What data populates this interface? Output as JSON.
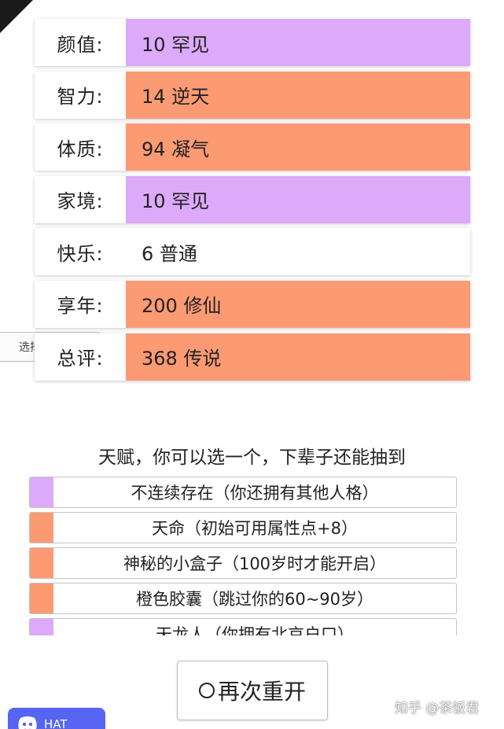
{
  "colors": {
    "purple": "#dcaaf8",
    "orange": "#fc9a74",
    "white": "#ffffff"
  },
  "stats": [
    {
      "label": "颜值:",
      "value": "10 罕见",
      "color": "#dcaaf8"
    },
    {
      "label": "智力:",
      "value": "14 逆天",
      "color": "#fc9a74"
    },
    {
      "label": "体质:",
      "value": "94 凝气",
      "color": "#fc9a74"
    },
    {
      "label": "家境:",
      "value": "10 罕见",
      "color": "#dcaaf8"
    },
    {
      "label": "快乐:",
      "value": "6 普通",
      "color": "#ffffff"
    },
    {
      "label": "享年:",
      "value": "200 修仙",
      "color": "#fc9a74"
    },
    {
      "label": "总评:",
      "value": "368 传说",
      "color": "#fc9a74"
    }
  ],
  "select_stub": {
    "label": "选择"
  },
  "talents": {
    "title": "天赋，你可以选一个，下辈子还能抽到",
    "items": [
      {
        "text": "不连续存在（你还拥有其他人格）",
        "color": "#dcaaf8"
      },
      {
        "text": "天命（初始可用属性点+8）",
        "color": "#fc9a74"
      },
      {
        "text": "神秘的小盒子（100岁时才能开启）",
        "color": "#fc9a74"
      },
      {
        "text": "橙色胶囊（跳过你的60~90岁）",
        "color": "#fc9a74"
      },
      {
        "text": "天龙人（你拥有北京户口）",
        "color": "#dcaaf8"
      }
    ]
  },
  "restart": {
    "label": "再次重开"
  },
  "discord": {
    "label": "HAT"
  },
  "watermark": {
    "text": "知乎 @茶饭君"
  }
}
